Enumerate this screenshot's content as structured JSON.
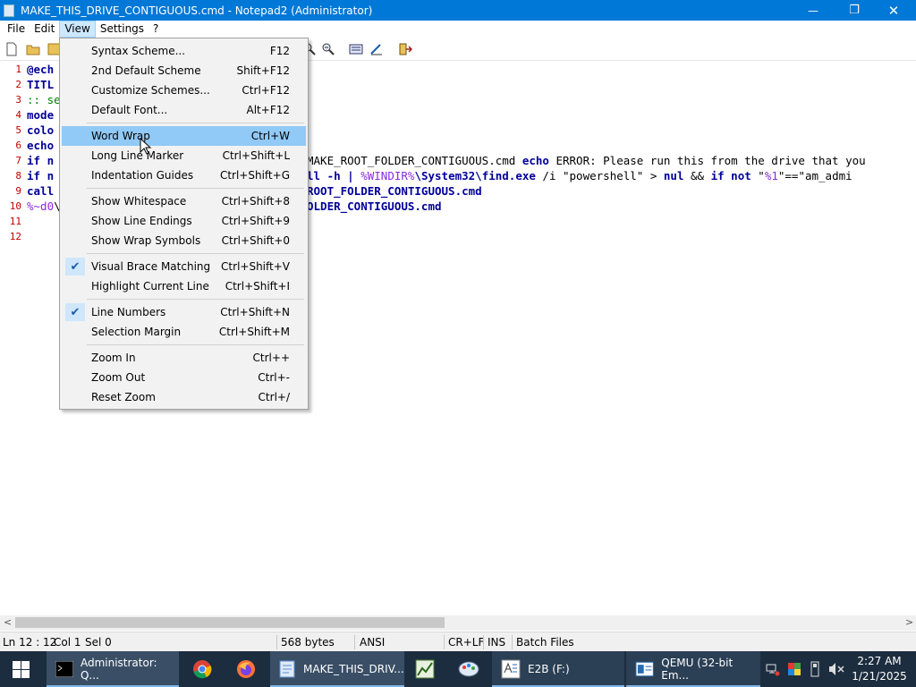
{
  "window": {
    "title": "MAKE_THIS_DRIVE_CONTIGUOUS.cmd - Notepad2 (Administrator)",
    "minimize_glyph": "—",
    "maximize_glyph": "❐",
    "close_glyph": "✕"
  },
  "menubar": {
    "items": [
      "File",
      "Edit",
      "View",
      "Settings",
      "?"
    ]
  },
  "editor": {
    "line_numbers": [
      "1",
      "2",
      "3",
      "4",
      "5",
      "6",
      "7",
      "8",
      "9",
      "10",
      "11",
      "12"
    ],
    "line1": "@ech",
    "line2": "TITL",
    "line3": ":: se",
    "line4": "mode",
    "line5": "colo",
    "line6": "echo",
    "line7a": "if n",
    "line7b": "MAKE_ROOT_FOLDER_CONTIGUOUS.cmd",
    "line7c": "echo",
    "line7d": "ERROR: Please run this from the drive that you",
    "line8a": "if n",
    "line8b": "ll -h | ",
    "line8c": "%WINDIR%",
    "line8d": "\\System32\\find.exe",
    "line8e": " /i \"powershell\" > ",
    "line8f": "nul",
    "line8g": " && ",
    "line8h": "if not",
    "line8i": " \"",
    "line8j": "%1",
    "line8k": "\"==\"am_admi",
    "line9a": "call",
    "line9b": "ROOT_FOLDER_CONTIGUOUS.cmd",
    "line10a": "%~d0",
    "line10b": "\\",
    "line10c": "OLDER_CONTIGUOUS.cmd"
  },
  "view_menu": {
    "items": [
      {
        "label": "Syntax Scheme...",
        "shortcut": "F12"
      },
      {
        "label": "2nd Default Scheme",
        "shortcut": "Shift+F12"
      },
      {
        "label": "Customize Schemes...",
        "shortcut": "Ctrl+F12"
      },
      {
        "label": "Default Font...",
        "shortcut": "Alt+F12"
      },
      {
        "label": "Word Wrap",
        "shortcut": "Ctrl+W",
        "highlighted": true
      },
      {
        "label": "Long Line Marker",
        "shortcut": "Ctrl+Shift+L"
      },
      {
        "label": "Indentation Guides",
        "shortcut": "Ctrl+Shift+G"
      },
      {
        "label": "Show Whitespace",
        "shortcut": "Ctrl+Shift+8"
      },
      {
        "label": "Show Line Endings",
        "shortcut": "Ctrl+Shift+9"
      },
      {
        "label": "Show Wrap Symbols",
        "shortcut": "Ctrl+Shift+0"
      },
      {
        "label": "Visual Brace Matching",
        "shortcut": "Ctrl+Shift+V",
        "checked": true
      },
      {
        "label": "Highlight Current Line",
        "shortcut": "Ctrl+Shift+I"
      },
      {
        "label": "Line Numbers",
        "shortcut": "Ctrl+Shift+N",
        "checked": true
      },
      {
        "label": "Selection Margin",
        "shortcut": "Ctrl+Shift+M"
      },
      {
        "label": "Zoom In",
        "shortcut": "Ctrl++"
      },
      {
        "label": "Zoom Out",
        "shortcut": "Ctrl+-"
      },
      {
        "label": "Reset Zoom",
        "shortcut": "Ctrl+/"
      }
    ],
    "check_glyph": "✔"
  },
  "statusbar": {
    "position": "Ln 12 : 12",
    "column": "Col 1",
    "selection": "Sel 0",
    "size": "568 bytes",
    "encoding": "ANSI",
    "line_ending": "CR+LF",
    "mode": "INS",
    "scheme": "Batch Files"
  },
  "scroll": {
    "left_arrow": "<",
    "right_arrow": ">"
  },
  "taskbar": {
    "items": [
      {
        "label": "Administrator: Q..."
      },
      {
        "label": "MAKE_THIS_DRIV..."
      },
      {
        "label": "E2B (F:)"
      },
      {
        "label": "QEMU (32-bit Em..."
      }
    ],
    "clock_time": "2:27 AM",
    "clock_date": "1/21/2025"
  },
  "colors": {
    "titlebar": "#0078d7",
    "menu_highlight": "#91c9f7",
    "taskbar": "#1c2d3f",
    "line_number": "#c00000",
    "keyword": "#00009a"
  }
}
